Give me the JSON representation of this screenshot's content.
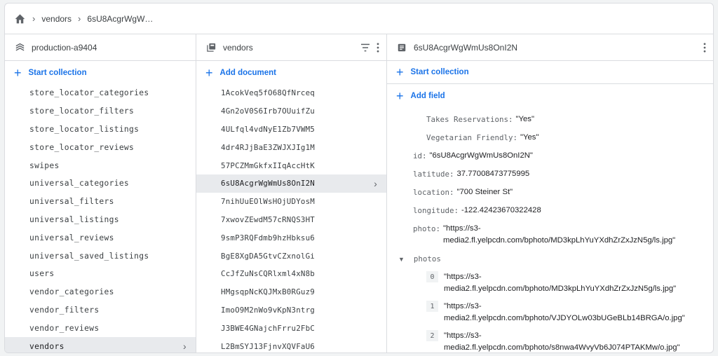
{
  "breadcrumb": {
    "items": [
      "vendors",
      "6sU8AcgrWgW…"
    ]
  },
  "panel_root": {
    "title": "production-a9404",
    "add_label": "Start collection",
    "collections": [
      "store_locator_categories",
      "store_locator_filters",
      "store_locator_listings",
      "store_locator_reviews",
      "swipes",
      "universal_categories",
      "universal_filters",
      "universal_listings",
      "universal_reviews",
      "universal_saved_listings",
      "users",
      "vendor_categories",
      "vendor_filters",
      "vendor_reviews",
      "vendors"
    ],
    "selected": "vendors"
  },
  "panel_collection": {
    "title": "vendors",
    "add_label": "Add document",
    "documents": [
      "1AcokVeq5fO68QfNrceq",
      "4Gn2oV0S6Irb7OUuifZu",
      "4ULfql4vdNyE1Zb7VWM5",
      "4dr4RJjBaE3ZWJXJIg1M",
      "57PCZMmGkfxIIqAccHtK",
      "6sU8AcgrWgWmUs8OnI2N",
      "7nihUuEOlWsHOjUDYosM",
      "7xwovZEwdM57cRNQS3HT",
      "9smP3RQFdmb9hzHbksu6",
      "BgE8XgDA5GtvCZxnolGi",
      "CcJfZuNsCQRlxml4xN8b",
      "HMgsqpNcKQJMxB0RGuz9",
      "ImoO9M2nWo9vKpN3ntrg",
      "J3BWE4GNajchFrru2FbC",
      "L2BmSYJ13FjnvXQVFaU6"
    ],
    "selected": "6sU8AcgrWgWmUs8OnI2N"
  },
  "panel_document": {
    "title": "6sU8AcgrWgWmUs8OnI2N",
    "start_collection_label": "Start collection",
    "add_field_label": "Add field",
    "nested_fields": [
      {
        "key": "Takes Reservations:",
        "value": "\"Yes\""
      },
      {
        "key": "Vegetarian Friendly:",
        "value": "\"Yes\""
      }
    ],
    "fields": [
      {
        "key": "id:",
        "value": "\"6sU8AcgrWgWmUs8OnI2N\""
      },
      {
        "key": "latitude:",
        "value": "37.77008473775995"
      },
      {
        "key": "location:",
        "value": "\"700 Steiner St\""
      },
      {
        "key": "longitude:",
        "value": "-122.42423670322428"
      },
      {
        "key": "photo:",
        "value": "\"https://s3-media2.fl.yelpcdn.com/bphoto/MD3kpLhYuYXdhZrZxJzN5g/ls.jpg\""
      }
    ],
    "photos_key": "photos",
    "photos": [
      {
        "index": "0",
        "value": "\"https://s3-media2.fl.yelpcdn.com/bphoto/MD3kpLhYuYXdhZrZxJzN5g/ls.jpg\""
      },
      {
        "index": "1",
        "value": "\"https://s3-media2.fl.yelpcdn.com/bphoto/VJDYOLw03bUGeBLb14BRGA/o.jpg\""
      },
      {
        "index": "2",
        "value": "\"https://s3-media2.fl.yelpcdn.com/bphoto/s8nwa4WvyVb6J074PTAKMw/o.jpg\""
      }
    ]
  },
  "colors": {
    "accent": "#1a73e8",
    "selected_bg": "#e8eaed",
    "border": "#dadce0"
  },
  "icons": {
    "home": "home-icon",
    "database": "database-icon",
    "collection": "collection-icon",
    "document": "document-icon",
    "filter": "filter-icon",
    "more": "more-vert-icon"
  }
}
